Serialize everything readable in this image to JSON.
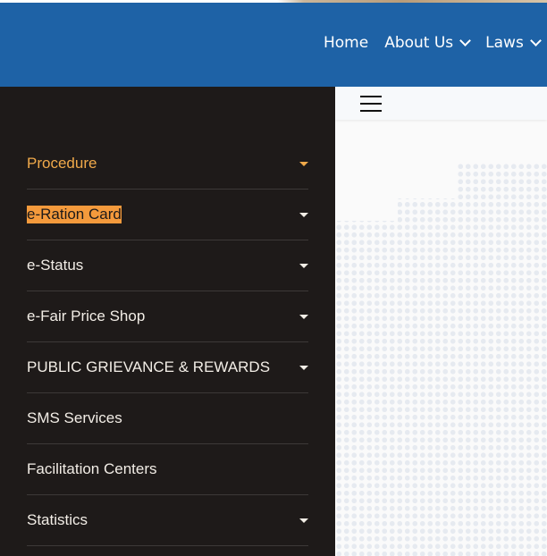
{
  "header": {
    "nav": [
      {
        "label": "Home",
        "has_dropdown": false
      },
      {
        "label": "About Us",
        "has_dropdown": true
      },
      {
        "label": "Laws",
        "has_dropdown": true
      }
    ]
  },
  "sidebar": {
    "items": [
      {
        "label": "Procedure",
        "has_dropdown": true,
        "state": "active"
      },
      {
        "label": "e-Ration Card",
        "has_dropdown": true,
        "state": "text-selected"
      },
      {
        "label": "e-Status",
        "has_dropdown": true
      },
      {
        "label": "e-Fair Price Shop",
        "has_dropdown": true
      },
      {
        "label": "PUBLIC GRIEVANCE & REWARDS",
        "has_dropdown": true
      },
      {
        "label": "SMS Services",
        "has_dropdown": false
      },
      {
        "label": "Facilitation Centers",
        "has_dropdown": false
      },
      {
        "label": "Statistics",
        "has_dropdown": true
      }
    ]
  },
  "colors": {
    "header_bg": "#1e62a6",
    "sidebar_bg": "#1e1a19",
    "active_text": "#f0a94a",
    "selection_highlight": "#f49a3c"
  },
  "icons": {
    "menu_toggle": "hamburger-icon",
    "dropdown": "caret-down-icon",
    "nav_dropdown": "chevron-down-icon"
  }
}
